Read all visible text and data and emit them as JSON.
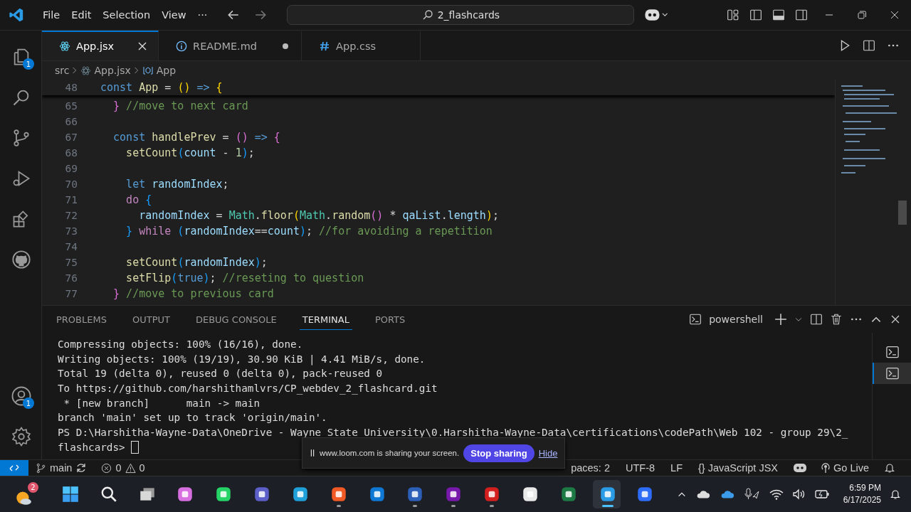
{
  "menu": [
    "File",
    "Edit",
    "Selection",
    "View",
    "···"
  ],
  "search": {
    "value": "2_flashcards"
  },
  "activity_bar": [
    {
      "kind": "files",
      "badge": "1",
      "selected": false
    },
    {
      "kind": "search",
      "selected": false
    },
    {
      "kind": "git",
      "selected": false
    },
    {
      "kind": "debug",
      "selected": false
    },
    {
      "kind": "extensions",
      "selected": false
    },
    {
      "kind": "github",
      "selected": false
    }
  ],
  "activity_bottom": [
    {
      "kind": "account",
      "badge": "1"
    },
    {
      "kind": "settings"
    }
  ],
  "tabs": [
    {
      "label": "App.jsx",
      "kind": "react",
      "selected": true,
      "modified": false
    },
    {
      "label": "README.md",
      "kind": "info",
      "selected": false,
      "modified": true
    },
    {
      "label": "App.css",
      "kind": "css",
      "selected": false,
      "modified": false
    }
  ],
  "breadcrumb": [
    "src",
    "App.jsx",
    "App"
  ],
  "sticky_line": {
    "number": "48",
    "tokens": [
      {
        "t": "const",
        "kind": "kw"
      },
      {
        "t": " App",
        "kind": "fn"
      },
      {
        "t": " = ",
        "kind": "op"
      },
      {
        "t": "()",
        "kind": "b1"
      },
      {
        "t": " =>",
        "kind": "kw"
      },
      {
        "t": " {",
        "kind": "b1"
      }
    ]
  },
  "code_lines": [
    {
      "number": "65",
      "tokens": [
        {
          "t": "  }",
          "kind": "b2"
        },
        {
          "t": " //move to next card",
          "kind": "cm"
        }
      ]
    },
    {
      "number": "66"
    },
    {
      "number": "67",
      "tokens": [
        {
          "t": "  const",
          "kind": "kw"
        },
        {
          "t": " handlePrev",
          "kind": "fn"
        },
        {
          "t": " = ",
          "kind": "op"
        },
        {
          "t": "()",
          "kind": "b2"
        },
        {
          "t": " =>",
          "kind": "kw"
        },
        {
          "t": " {",
          "kind": "b2"
        }
      ]
    },
    {
      "number": "68",
      "tokens": [
        {
          "t": "    setCount",
          "kind": "fn"
        },
        {
          "t": "(",
          "kind": "b3"
        },
        {
          "t": "count",
          "kind": "var"
        },
        {
          "t": " - ",
          "kind": "op"
        },
        {
          "t": "1",
          "kind": "num"
        },
        {
          "t": ")",
          "kind": "b3"
        },
        {
          "t": ";",
          "kind": "op"
        }
      ]
    },
    {
      "number": "69"
    },
    {
      "number": "70",
      "tokens": [
        {
          "t": "    let",
          "kind": "kw"
        },
        {
          "t": " randomIndex",
          "kind": "var"
        },
        {
          "t": ";",
          "kind": "op"
        }
      ]
    },
    {
      "number": "71",
      "tokens": [
        {
          "t": "    do",
          "kind": "ctl"
        },
        {
          "t": " {",
          "kind": "b3"
        }
      ]
    },
    {
      "number": "72",
      "tokens": [
        {
          "t": "      randomIndex",
          "kind": "var"
        },
        {
          "t": " = ",
          "kind": "op"
        },
        {
          "t": "Math",
          "kind": "cls"
        },
        {
          "t": ".",
          "kind": "op"
        },
        {
          "t": "floor",
          "kind": "fn"
        },
        {
          "t": "(",
          "kind": "b1"
        },
        {
          "t": "Math",
          "kind": "cls"
        },
        {
          "t": ".",
          "kind": "op"
        },
        {
          "t": "random",
          "kind": "fn"
        },
        {
          "t": "()",
          "kind": "b2"
        },
        {
          "t": " * ",
          "kind": "op"
        },
        {
          "t": "qaList",
          "kind": "var"
        },
        {
          "t": ".",
          "kind": "op"
        },
        {
          "t": "length",
          "kind": "var"
        },
        {
          "t": ")",
          "kind": "b1"
        },
        {
          "t": ";",
          "kind": "op"
        }
      ]
    },
    {
      "number": "73",
      "tokens": [
        {
          "t": "    }",
          "kind": "b3"
        },
        {
          "t": " while",
          "kind": "ctl"
        },
        {
          "t": " (",
          "kind": "b3"
        },
        {
          "t": "randomIndex",
          "kind": "var"
        },
        {
          "t": "==",
          "kind": "op"
        },
        {
          "t": "count",
          "kind": "var"
        },
        {
          "t": ")",
          "kind": "b3"
        },
        {
          "t": ";",
          "kind": "op"
        },
        {
          "t": " //for avoiding a repetition",
          "kind": "cm"
        }
      ]
    },
    {
      "number": "74"
    },
    {
      "number": "75",
      "tokens": [
        {
          "t": "    setCount",
          "kind": "fn"
        },
        {
          "t": "(",
          "kind": "b3"
        },
        {
          "t": "randomIndex",
          "kind": "var"
        },
        {
          "t": ")",
          "kind": "b3"
        },
        {
          "t": ";",
          "kind": "op"
        }
      ]
    },
    {
      "number": "76",
      "tokens": [
        {
          "t": "    setFlip",
          "kind": "fn"
        },
        {
          "t": "(",
          "kind": "b3"
        },
        {
          "t": "true",
          "kind": "kw"
        },
        {
          "t": ")",
          "kind": "b3"
        },
        {
          "t": ";",
          "kind": "op"
        },
        {
          "t": " //reseting to question",
          "kind": "cm"
        }
      ]
    },
    {
      "number": "77",
      "tokens": [
        {
          "t": "  }",
          "kind": "b2"
        },
        {
          "t": " //move to previous card",
          "kind": "cm"
        }
      ]
    }
  ],
  "panel_tabs": [
    {
      "label": "PROBLEMS",
      "selected": false
    },
    {
      "label": "OUTPUT",
      "selected": false
    },
    {
      "label": "DEBUG CONSOLE",
      "selected": false
    },
    {
      "label": "TERMINAL",
      "selected": true
    },
    {
      "label": "PORTS",
      "selected": false
    }
  ],
  "terminal_name": "powershell",
  "terminal_lines": [
    "Compressing objects: 100% (16/16), done.",
    "Writing objects: 100% (19/19), 30.90 KiB | 4.41 MiB/s, done.",
    "Total 19 (delta 0), reused 0 (delta 0), pack-reused 0",
    "To https://github.com/harshithamlvrs/CP_webdev_2_flashcard.git",
    " * [new branch]      main -> main",
    "branch 'main' set up to track 'origin/main'.",
    "PS D:\\Harshitha-Wayne-Data\\OneDrive - Wayne State University\\0.Harshitha-Wayne-Data\\certifications\\codePath\\Web 102 - group 29\\2_"
  ],
  "prompt": "flashcards> ",
  "terminal_list": [
    {
      "selected": false
    },
    {
      "selected": true
    }
  ],
  "status_left": {
    "branch": "main",
    "errors": "0",
    "warnings": "0"
  },
  "status_right": [
    "paces: 2",
    "UTF-8",
    "LF",
    "{} JavaScript JSX",
    "Go Live"
  ],
  "share_bar": {
    "message": "www.loom.com is sharing your screen.",
    "stop": "Stop sharing",
    "hide": "Hide"
  },
  "taskbar": {
    "weather_badge": "2",
    "apps": [
      {
        "kind": "start",
        "running": false
      },
      {
        "kind": "search",
        "running": false
      },
      {
        "kind": "taskview",
        "running": false
      },
      {
        "kind": "copilot",
        "running": false
      },
      {
        "kind": "whatsapp",
        "running": false
      },
      {
        "kind": "teams",
        "running": false
      },
      {
        "kind": "edge",
        "running": false
      },
      {
        "kind": "brave",
        "running": true
      },
      {
        "kind": "outlook",
        "running": false
      },
      {
        "kind": "word",
        "running": true
      },
      {
        "kind": "onenote",
        "running": true
      },
      {
        "kind": "pdf",
        "running": true
      },
      {
        "kind": "slack",
        "running": false
      },
      {
        "kind": "excel",
        "running": false
      },
      {
        "kind": "vscode",
        "running": true
      },
      {
        "kind": "zoom",
        "running": false
      }
    ],
    "time": "6:59 PM",
    "date": "6/17/2025"
  }
}
